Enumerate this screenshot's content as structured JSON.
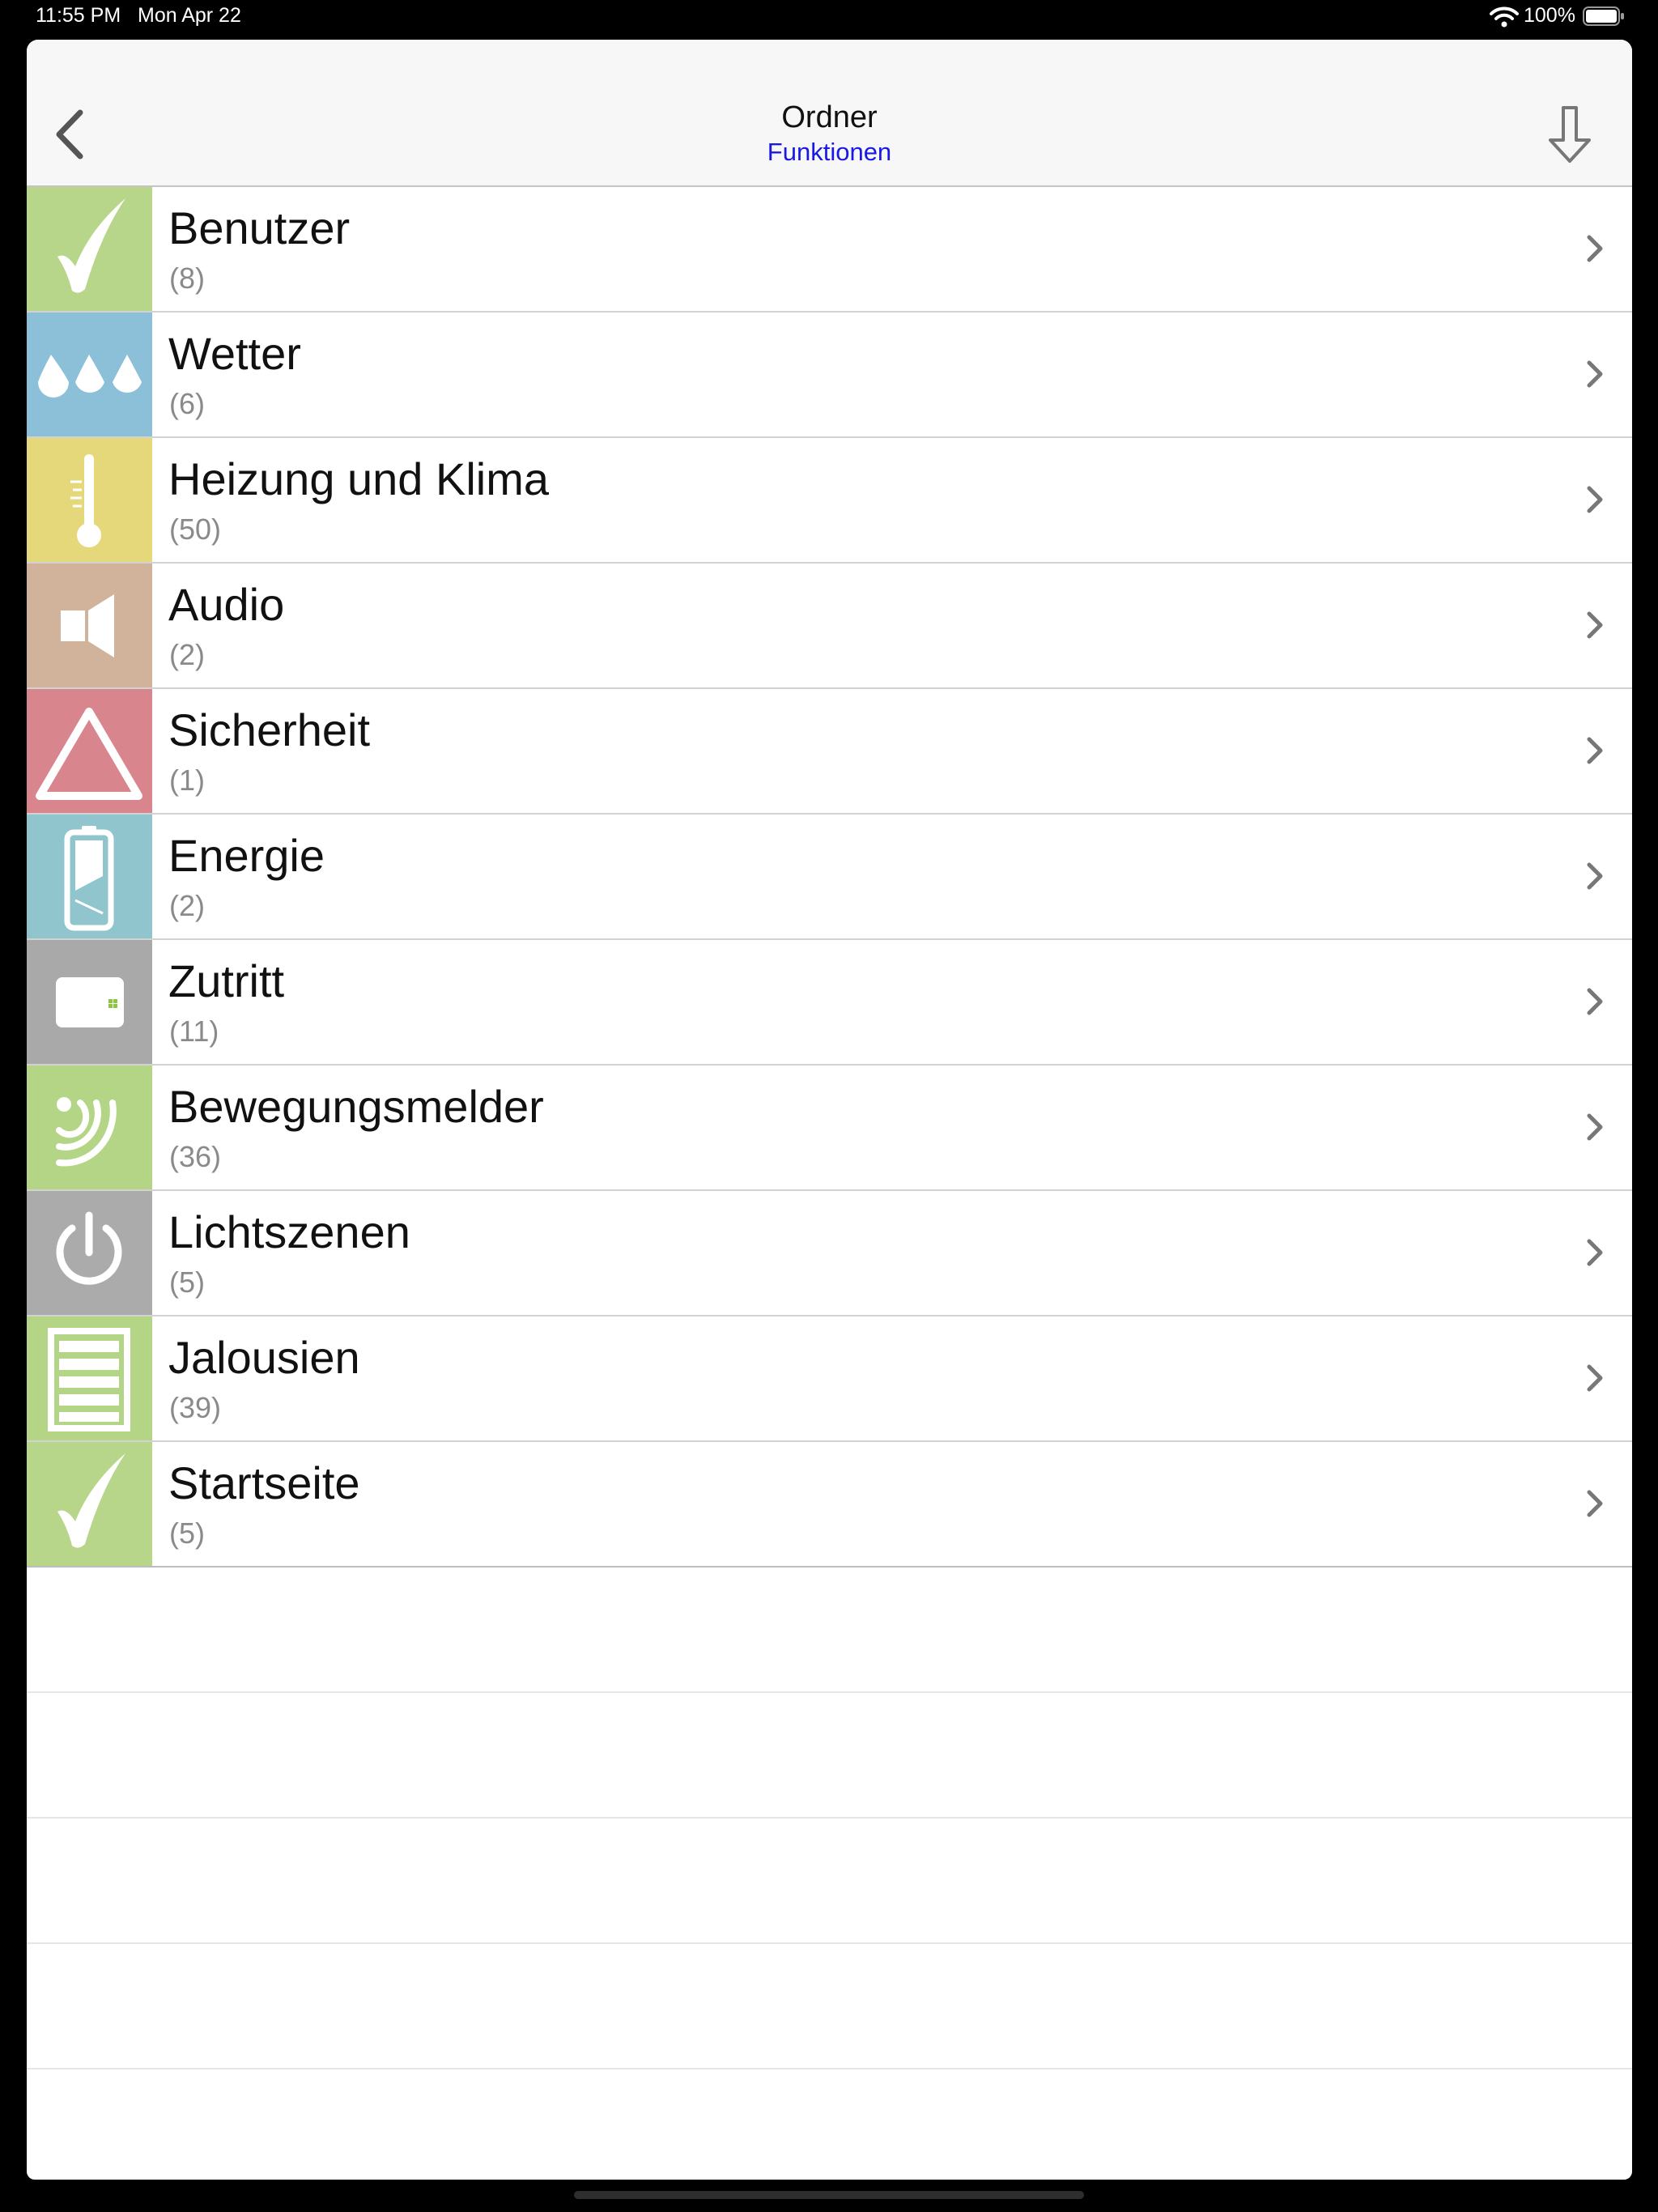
{
  "status_bar": {
    "time": "11:55 PM",
    "date": "Mon Apr 22",
    "battery": "100%"
  },
  "navbar": {
    "title": "Ordner",
    "subtitle": "Funktionen",
    "back_icon": "chevron-left-icon",
    "action_icon": "download-arrow-icon"
  },
  "colors": {
    "subtitle": "#1919e6",
    "green": "#a9cf7c",
    "blue": "#86bcd6",
    "yellow": "#e6d877",
    "tan": "#d2b39a",
    "red": "#d98890",
    "teal": "#8fc6cf",
    "gray": "#a8a8a8"
  },
  "items": [
    {
      "label": "Benutzer",
      "count": "(8)",
      "icon": "checkmark-icon",
      "color": "#b7d68a"
    },
    {
      "label": "Wetter",
      "count": "(6)",
      "icon": "water-drops-icon",
      "color": "#8cbfd8"
    },
    {
      "label": "Heizung und Klima",
      "count": "(50)",
      "icon": "thermometer-icon",
      "color": "#e5d87a"
    },
    {
      "label": "Audio",
      "count": "(2)",
      "icon": "speaker-icon",
      "color": "#d1b39b"
    },
    {
      "label": "Sicherheit",
      "count": "(1)",
      "icon": "warning-triangle-icon",
      "color": "#d9858d"
    },
    {
      "label": "Energie",
      "count": "(2)",
      "icon": "battery-icon",
      "color": "#90c5ce"
    },
    {
      "label": "Zutritt",
      "count": "(11)",
      "icon": "access-card-icon",
      "color": "#a9a9a9"
    },
    {
      "label": "Bewegungsmelder",
      "count": "(36)",
      "icon": "motion-sensor-icon",
      "color": "#b5d586"
    },
    {
      "label": "Lichtszenen",
      "count": "(5)",
      "icon": "power-icon",
      "color": "#ababab"
    },
    {
      "label": "Jalousien",
      "count": "(39)",
      "icon": "blinds-icon",
      "color": "#b5d586"
    },
    {
      "label": "Startseite",
      "count": "(5)",
      "icon": "checkmark-icon",
      "color": "#b7d68a"
    }
  ]
}
